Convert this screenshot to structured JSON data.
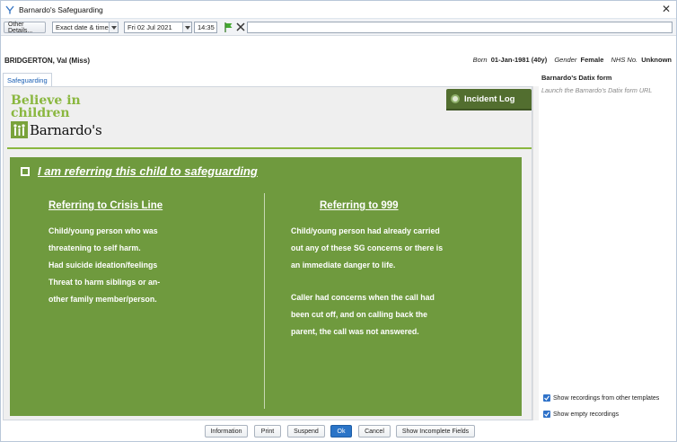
{
  "window": {
    "title": "Barnardo's Safeguarding",
    "close_glyph": "✕"
  },
  "toolbar": {
    "other_details_label": "Other Details...",
    "date_mode_value": "Exact date & time",
    "date_value": "Fri 02 Jul 2021",
    "time_value": "14:35",
    "free_text_value": ""
  },
  "patient": {
    "name": "BRIDGERTON, Val (Miss)",
    "born_label": "Born",
    "born_value": "01-Jan-1981 (40y)",
    "gender_label": "Gender",
    "gender_value": "Female",
    "nhs_label": "NHS No.",
    "nhs_value": "Unknown"
  },
  "tabs": [
    {
      "label": "Safeguarding"
    }
  ],
  "logo": {
    "line1": "Believe in",
    "line2": "children",
    "brand": "Barnardo's"
  },
  "incident_log_label": "Incident Log",
  "referral": {
    "checkbox_label": "I am referring this child to safeguarding",
    "crisis": {
      "heading": "Referring to Crisis Line",
      "lines": [
        "Child/young person who was",
        "threatening to self harm.",
        "Had suicide ideation/feelings",
        "Threat to harm siblings or an-",
        "other family member/person."
      ]
    },
    "emergency": {
      "heading": "Referring to 999",
      "lines": [
        "Child/young person had already carried",
        "out any of these SG concerns or there is",
        "an immediate danger to life."
      ],
      "lines2": [
        "Caller had concerns when the call had",
        "been cut off, and on calling back the",
        "parent, the call was not answered."
      ]
    }
  },
  "side_panel": {
    "title": "Barnardo's Datix form",
    "link": "Launch the Barnardo's Datix form URL",
    "show_other_templates": "Show recordings from other templates",
    "show_empty": "Show empty recordings"
  },
  "footer": {
    "information": "Information",
    "print": "Print",
    "suspend": "Suspend",
    "ok": "Ok",
    "cancel": "Cancel",
    "show_incomplete": "Show Incomplete Fields"
  },
  "colors": {
    "panel_green": "#6f9a3e",
    "logo_green": "#8ab73f",
    "incident_green": "#526e2f",
    "primary_blue": "#2a74c7"
  }
}
